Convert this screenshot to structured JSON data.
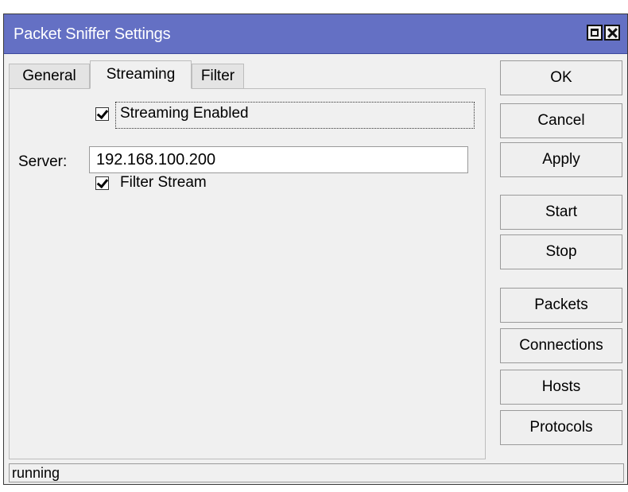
{
  "window": {
    "title": "Packet Sniffer Settings"
  },
  "tabs": [
    {
      "label": "General"
    },
    {
      "label": "Streaming"
    },
    {
      "label": "Filter"
    }
  ],
  "streaming": {
    "streaming_enabled": {
      "label": "Streaming Enabled",
      "checked": true
    },
    "server": {
      "label": "Server:",
      "value": "192.168.100.200"
    },
    "filter_stream": {
      "label": "Filter Stream",
      "checked": true
    }
  },
  "buttons": {
    "ok": "OK",
    "cancel": "Cancel",
    "apply": "Apply",
    "start": "Start",
    "stop": "Stop",
    "packets": "Packets",
    "connections": "Connections",
    "hosts": "Hosts",
    "protocols": "Protocols"
  },
  "status": {
    "text": "running"
  },
  "colors": {
    "titlebar": "#6470c4",
    "background": "#f0f0f0"
  }
}
